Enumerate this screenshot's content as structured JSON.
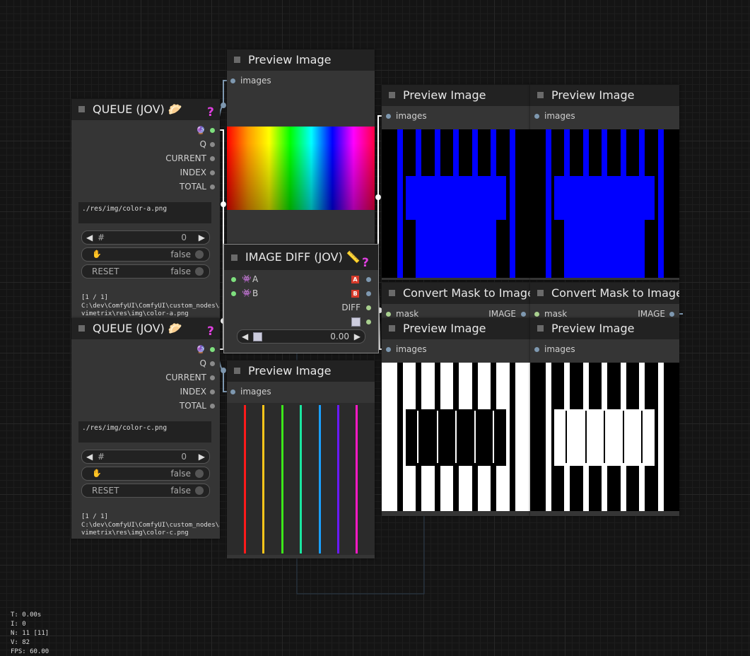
{
  "colors": {
    "canvas": "#141414",
    "node_body": "#353535",
    "node_title": "#222222",
    "link": "#ffffff",
    "link_image": "#7e98b0",
    "help": "#e040e0",
    "badge": "#d63a2a"
  },
  "queue_a": {
    "title": "QUEUE (JOV) 🥟",
    "help_icon": "?",
    "outputs": [
      "Q",
      "CURRENT",
      "INDEX",
      "TOTAL"
    ],
    "path_text": "./res/img/color-a.png",
    "index_label": "#",
    "index_value": "0",
    "hold_value": "false",
    "reset_label": "RESET",
    "reset_value": "false",
    "status": "[1 / 1]",
    "current_path_1": "C:\\dev\\ComfyUI\\ComfyUI\\custom_nodes\\Jo",
    "current_path_2": "vimetrix\\res\\img\\color-a.png"
  },
  "queue_c": {
    "title": "QUEUE (JOV) 🥟",
    "help_icon": "?",
    "outputs": [
      "Q",
      "CURRENT",
      "INDEX",
      "TOTAL"
    ],
    "path_text": "./res/img/color-c.png",
    "index_label": "#",
    "index_value": "0",
    "hold_value": "false",
    "reset_label": "RESET",
    "reset_value": "false",
    "status": "[1 / 1]",
    "current_path_1": "C:\\dev\\ComfyUI\\ComfyUI\\custom_nodes\\Jo",
    "current_path_2": "vimetrix\\res\\img\\color-c.png"
  },
  "preview_top": {
    "title": "Preview Image",
    "input": "images"
  },
  "preview_bottom": {
    "title": "Preview Image",
    "input": "images"
  },
  "preview_right_1": {
    "title": "Preview Image",
    "input": "images"
  },
  "preview_right_2": {
    "title": "Preview Image",
    "input": "images"
  },
  "preview_right_3": {
    "title": "Preview Image",
    "input": "images"
  },
  "preview_right_4": {
    "title": "Preview Image",
    "input": "images"
  },
  "image_diff": {
    "title": "IMAGE DIFF (JOV) 📏",
    "help_icon": "?",
    "input_a": "A",
    "input_b": "B",
    "output_a_badge": "A",
    "output_b_badge": "B",
    "output_diff": "DIFF",
    "threshold_value": "0.00"
  },
  "mask_1": {
    "title": "Convert Mask to Image",
    "input": "mask",
    "output": "IMAGE"
  },
  "mask_2": {
    "title": "Convert Mask to Image",
    "input": "mask",
    "output": "IMAGE"
  },
  "stats": {
    "time": "T: 0.00s",
    "i": "I: 0",
    "n": "N: 11 [11]",
    "v": "V: 82",
    "fps": "FPS: 60.00"
  },
  "bar_colors": [
    "#ff1a1a",
    "#ffc61a",
    "#3ce61a",
    "#1ae6a0",
    "#1aa0ff",
    "#6a1aff",
    "#ff1ac6"
  ]
}
